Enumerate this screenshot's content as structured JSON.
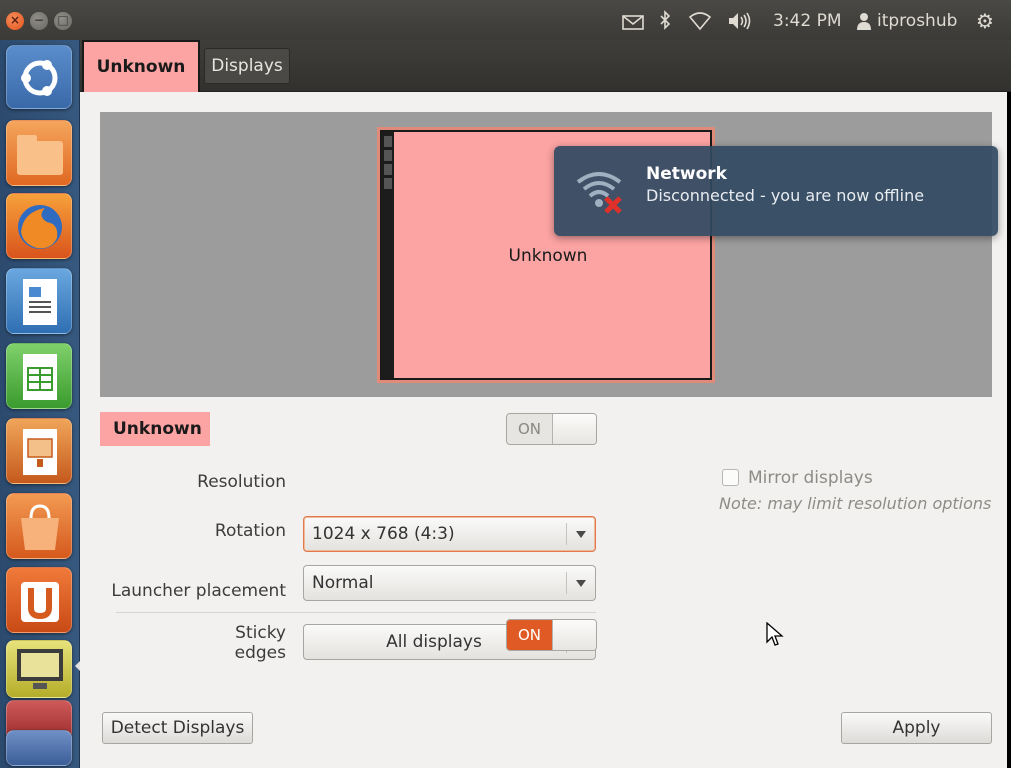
{
  "panel": {
    "clock": "3:42 PM",
    "user": "itproshub"
  },
  "icons": {
    "mail": "mail-icon",
    "bluetooth": "bluetooth-icon",
    "wifi": "wifi-icon",
    "sound": "volume-icon",
    "user": "user-icon",
    "settings": "gear-icon"
  },
  "tabs": {
    "monitor": "Unknown",
    "displays": "Displays"
  },
  "preview": {
    "monitor_label": "Unknown"
  },
  "display": {
    "name": "Unknown",
    "power_state": "ON",
    "resolution_label": "Resolution",
    "resolution_value": "1024 x 768 (4:3)",
    "rotation_label": "Rotation",
    "rotation_value": "Normal",
    "launcher_label": "Launcher placement",
    "launcher_value": "All displays",
    "sticky_label": "Sticky edges",
    "sticky_state": "ON",
    "mirror_label": "Mirror displays",
    "mirror_note": "Note: may limit resolution options"
  },
  "buttons": {
    "detect": "Detect Displays",
    "apply": "Apply"
  },
  "notification": {
    "title": "Network",
    "body": "Disconnected - you are now offline"
  },
  "colors": {
    "accent": "#e05a25",
    "monitor": "#fca3a3",
    "launcher": "#2b4a6e",
    "notification": "#324a62"
  }
}
